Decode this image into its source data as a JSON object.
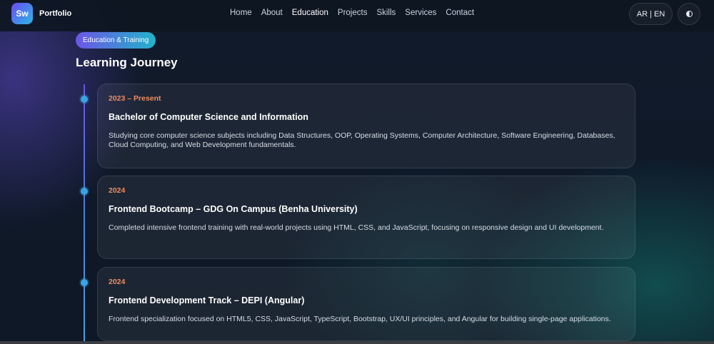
{
  "brand": {
    "logo_text": "Sw",
    "name": "Portfolio"
  },
  "nav": {
    "links": [
      {
        "label": "Home",
        "active": false
      },
      {
        "label": "About",
        "active": false
      },
      {
        "label": "Education",
        "active": true
      },
      {
        "label": "Projects",
        "active": false
      },
      {
        "label": "Skills",
        "active": false
      },
      {
        "label": "Services",
        "active": false
      },
      {
        "label": "Contact",
        "active": false
      }
    ],
    "lang_toggle": "AR | EN",
    "theme_icon": "contrast-icon"
  },
  "section": {
    "badge": "Education & Training",
    "title": "Learning Journey"
  },
  "timeline": [
    {
      "date": "2023 – Present",
      "title": "Bachelor of Computer Science and Information",
      "description": "Studying core computer science subjects including Data Structures, OOP, Operating Systems, Computer Architecture, Software Engineering, Databases, Cloud Computing, and Web Development fundamentals."
    },
    {
      "date": "2024",
      "title": "Frontend Bootcamp – GDG On Campus (Benha University)",
      "description": "Completed intensive frontend training with real-world projects using HTML, CSS, and JavaScript, focusing on responsive design and UI development."
    },
    {
      "date": "2024",
      "title": "Frontend Development Track – DEPI (Angular)",
      "description": "Frontend specialization focused on HTML5, CSS, JavaScript, TypeScript, Bootstrap, UX/UI principles, and Angular for building single-page applications."
    }
  ],
  "colors": {
    "accent_date": "#f08a5d",
    "timeline_dot": "#3ba3e4",
    "badge_start": "#6b56e6",
    "badge_end": "#22b3c9"
  }
}
